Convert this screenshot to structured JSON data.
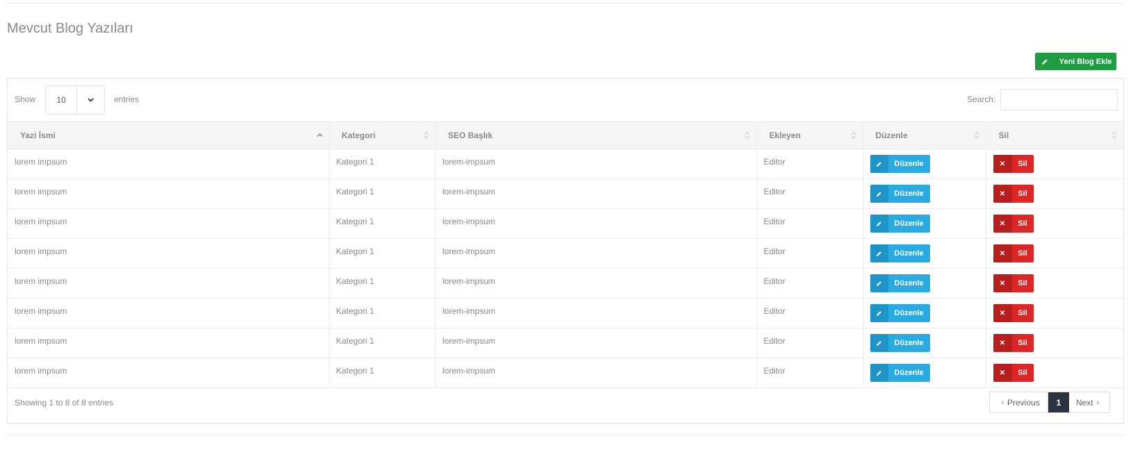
{
  "page": {
    "title": "Mevcut Blog Yazıları",
    "new_button_label": "Yeni Blog Ekle"
  },
  "controls": {
    "show_label": "Show",
    "length_value": "10",
    "entries_label": "entries",
    "search_label": "Search:",
    "search_value": ""
  },
  "table": {
    "columns": [
      "Yazi İsmi",
      "Kategori",
      "SEO Başlık",
      "Ekleyen",
      "Düzenle",
      "Sil"
    ],
    "sort_state": [
      "asc",
      "none",
      "none",
      "none",
      "none",
      "none"
    ],
    "rows": [
      {
        "name": "lorem impsum",
        "category": "Kategori 1",
        "seo": "lorem-impsum",
        "author": "Editor",
        "edit_label": "Düzenle",
        "delete_label": "Sil"
      },
      {
        "name": "lorem impsum",
        "category": "Kategori 1",
        "seo": "lorem-impsum",
        "author": "Editor",
        "edit_label": "Düzenle",
        "delete_label": "Sil"
      },
      {
        "name": "lorem impsum",
        "category": "Kategori 1",
        "seo": "lorem-impsum",
        "author": "Editor",
        "edit_label": "Düzenle",
        "delete_label": "Sil"
      },
      {
        "name": "lorem impsum",
        "category": "Kategori 1",
        "seo": "lorem-impsum",
        "author": "Editor",
        "edit_label": "Düzenle",
        "delete_label": "Sil"
      },
      {
        "name": "lorem impsum",
        "category": "Kategori 1",
        "seo": "lorem-impsum",
        "author": "Editor",
        "edit_label": "Düzenle",
        "delete_label": "Sil"
      },
      {
        "name": "lorem impsum",
        "category": "Kategori 1",
        "seo": "lorem-impsum",
        "author": "Editor",
        "edit_label": "Düzenle",
        "delete_label": "Sil"
      },
      {
        "name": "lorem impsum",
        "category": "Kategori 1",
        "seo": "lorem-impsum",
        "author": "Editor",
        "edit_label": "Düzenle",
        "delete_label": "Sil"
      },
      {
        "name": "lorem impsum",
        "category": "Kategori 1",
        "seo": "lorem-impsum",
        "author": "Editor",
        "edit_label": "Düzenle",
        "delete_label": "Sil"
      }
    ]
  },
  "footer": {
    "info": "Showing 1 to 8 of 8 entries",
    "prev_label": "Previous",
    "current_page": "1",
    "next_label": "Next"
  },
  "icons": {
    "new": "pencil-icon",
    "edit": "pencil-icon",
    "delete": "times-icon",
    "sort": "sort-arrows-icon",
    "select": "chevron-down-icon"
  },
  "colors": {
    "success": "#1e9d43",
    "info": "#29abe2",
    "danger": "#dd2727",
    "pager_active": "#2b3341"
  }
}
